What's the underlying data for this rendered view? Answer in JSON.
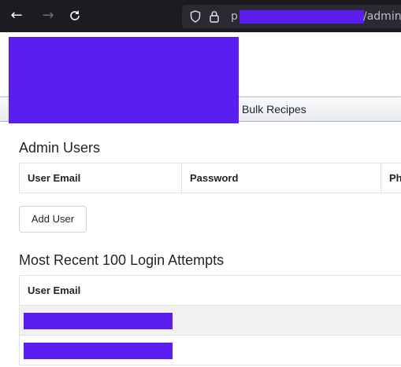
{
  "browser": {
    "back_glyph": "←",
    "forward_glyph": "→",
    "reload_glyph": "C",
    "shield_glyph": "⬡",
    "lock_glyph": "🔒",
    "url_prefix": "p",
    "url_suffix": "/admin",
    "icons": [
      "back-arrow-icon",
      "forward-arrow-icon",
      "reload-icon",
      "shield-icon",
      "lock-icon"
    ]
  },
  "nav": {
    "items": [
      {
        "label": "Bulk Recipes"
      }
    ]
  },
  "admin_users": {
    "title": "Admin Users",
    "columns": [
      "User Email",
      "Password",
      "Ph"
    ],
    "add_button": "Add User"
  },
  "login_attempts": {
    "title": "Most Recent 100 Login Attempts",
    "columns": [
      "User Email"
    ],
    "rows": [
      {
        "email": ""
      },
      {
        "email": ""
      }
    ]
  },
  "colors": {
    "redaction": "#5b1ef0",
    "browser_chrome": "#1c1b22"
  }
}
